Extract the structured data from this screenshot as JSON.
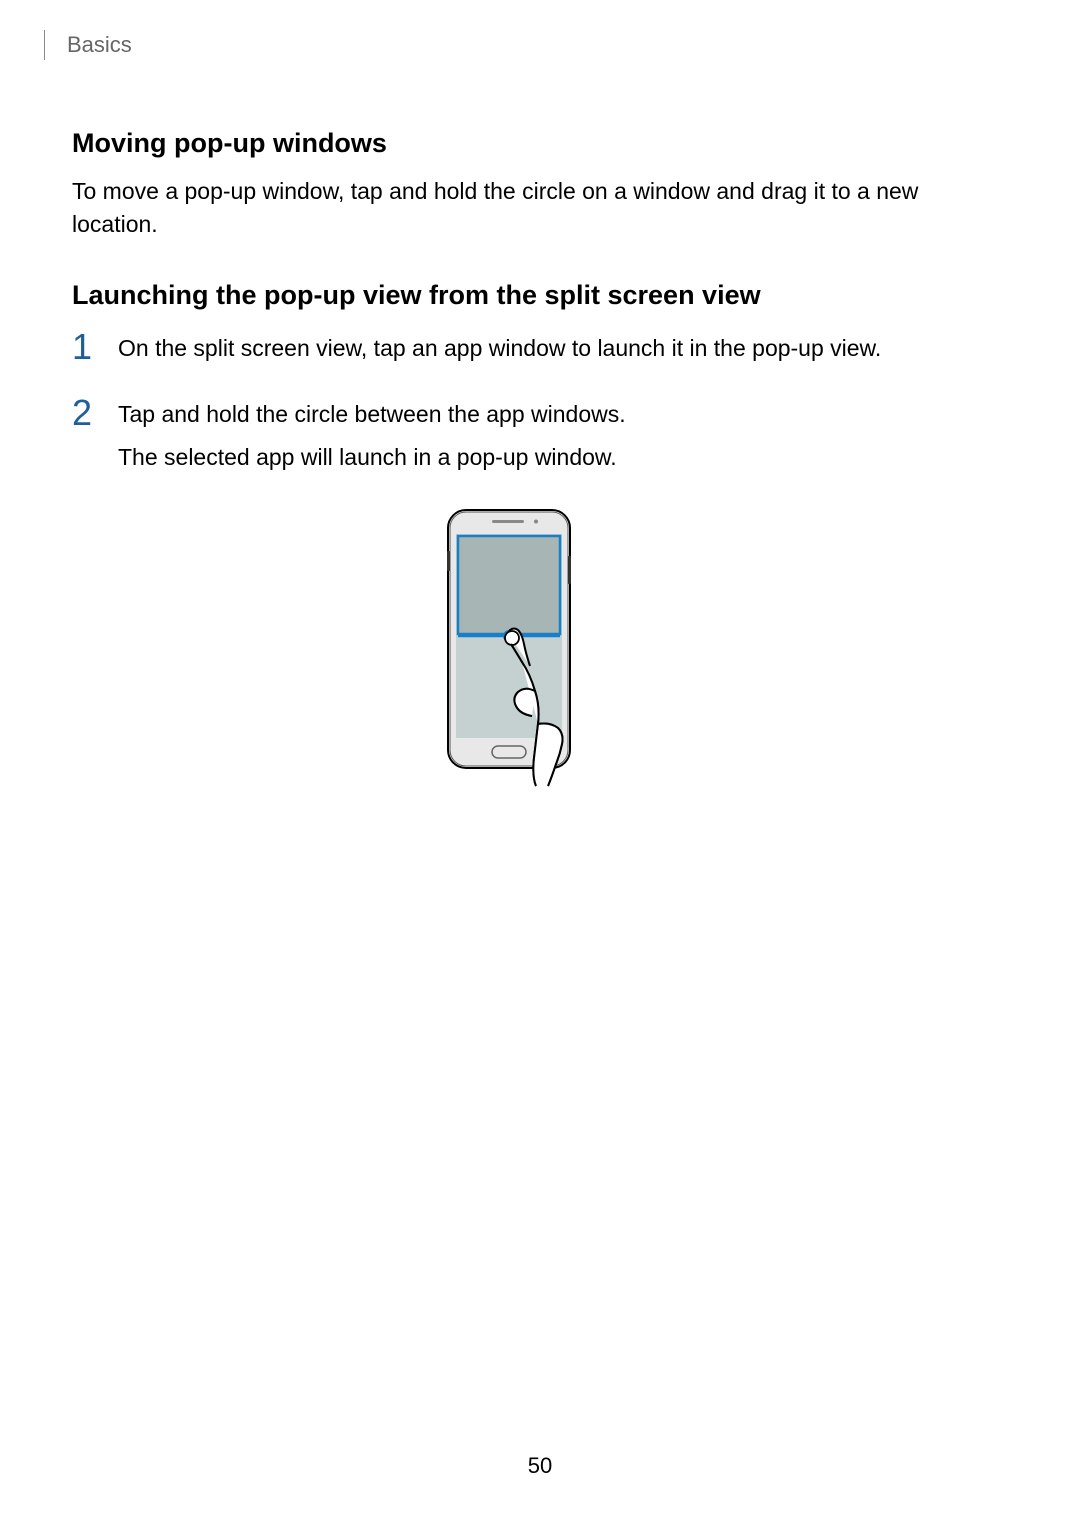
{
  "breadcrumb": "Basics",
  "section1": {
    "heading": "Moving pop-up windows",
    "body": "To move a pop-up window, tap and hold the circle on a window and drag it to a new location."
  },
  "section2": {
    "heading": "Launching the pop-up view from the split screen view",
    "steps": [
      {
        "number": "1",
        "text": "On the split screen view, tap an app window to launch it in the pop-up view."
      },
      {
        "number": "2",
        "text": "Tap and hold the circle between the app windows.",
        "subtext": "The selected app will launch in a pop-up window."
      }
    ]
  },
  "page_number": "50"
}
